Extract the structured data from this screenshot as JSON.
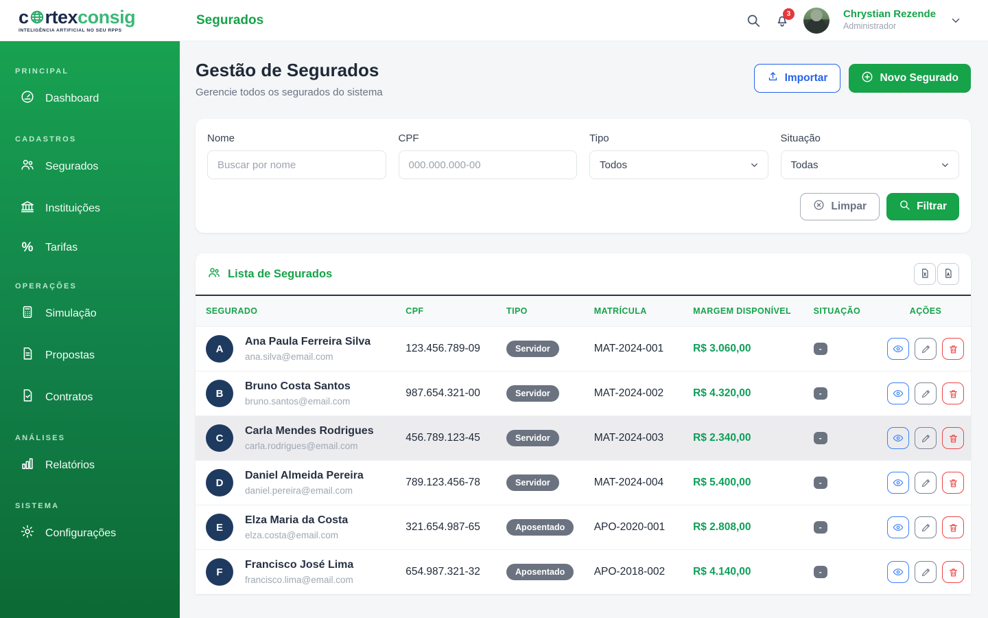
{
  "brand": {
    "part1": "c",
    "part2": "rtex",
    "part3": "consig",
    "tagline": "INTELIGÊNCIA ARTIFICIAL NO SEU RPPS"
  },
  "topbar": {
    "page_label": "Segurados",
    "notification_count": "3",
    "user": {
      "name": "Chrystian Rezende",
      "role": "Administrador"
    }
  },
  "sidebar": {
    "sections": [
      {
        "label": "PRINCIPAL",
        "items": [
          {
            "label": "Dashboard",
            "icon": "gauge-icon"
          }
        ]
      },
      {
        "label": "CADASTROS",
        "items": [
          {
            "label": "Segurados",
            "icon": "people-icon"
          },
          {
            "label": "Instituições",
            "icon": "bank-icon"
          },
          {
            "label": "Tarifas",
            "icon": "percent-icon"
          }
        ]
      },
      {
        "label": "OPERAÇÕES",
        "items": [
          {
            "label": "Simulação",
            "icon": "calculator-icon"
          },
          {
            "label": "Propostas",
            "icon": "document-icon"
          },
          {
            "label": "Contratos",
            "icon": "contract-icon"
          }
        ]
      },
      {
        "label": "ANÁLISES",
        "items": [
          {
            "label": "Relatórios",
            "icon": "bar-chart-icon"
          }
        ]
      },
      {
        "label": "SISTEMA",
        "items": [
          {
            "label": "Configurações",
            "icon": "gear-icon"
          }
        ]
      }
    ]
  },
  "page": {
    "title": "Gestão de Segurados",
    "subtitle": "Gerencie todos os segurados do sistema",
    "import_label": "Importar",
    "new_label": "Novo Segurado"
  },
  "filters": {
    "fields": [
      {
        "label": "Nome",
        "placeholder": "Buscar por nome"
      },
      {
        "label": "CPF",
        "placeholder": "000.000.000-00"
      },
      {
        "label": "Tipo",
        "value": "Todos"
      },
      {
        "label": "Situação",
        "value": "Todas"
      }
    ],
    "clear_label": "Limpar",
    "apply_label": "Filtrar"
  },
  "list": {
    "title": "Lista de Segurados",
    "columns": [
      "SEGURADO",
      "CPF",
      "TIPO",
      "MATRÍCULA",
      "MARGEM DISPONÍVEL",
      "SITUAÇÃO",
      "AÇÕES"
    ],
    "rows": [
      {
        "initial": "A",
        "name": "Ana Paula Ferreira Silva",
        "email": "ana.silva@email.com",
        "cpf": "123.456.789-09",
        "tipo": "Servidor",
        "matricula": "MAT-2024-001",
        "margem": "R$ 3.060,00",
        "situacao": "-"
      },
      {
        "initial": "B",
        "name": "Bruno Costa Santos",
        "email": "bruno.santos@email.com",
        "cpf": "987.654.321-00",
        "tipo": "Servidor",
        "matricula": "MAT-2024-002",
        "margem": "R$ 4.320,00",
        "situacao": "-"
      },
      {
        "initial": "C",
        "name": "Carla Mendes Rodrigues",
        "email": "carla.rodrigues@email.com",
        "cpf": "456.789.123-45",
        "tipo": "Servidor",
        "matricula": "MAT-2024-003",
        "margem": "R$ 2.340,00",
        "situacao": "-"
      },
      {
        "initial": "D",
        "name": "Daniel Almeida Pereira",
        "email": "daniel.pereira@email.com",
        "cpf": "789.123.456-78",
        "tipo": "Servidor",
        "matricula": "MAT-2024-004",
        "margem": "R$ 5.400,00",
        "situacao": "-"
      },
      {
        "initial": "E",
        "name": "Elza Maria da Costa",
        "email": "elza.costa@email.com",
        "cpf": "321.654.987-65",
        "tipo": "Aposentado",
        "matricula": "APO-2020-001",
        "margem": "R$ 2.808,00",
        "situacao": "-"
      },
      {
        "initial": "F",
        "name": "Francisco José Lima",
        "email": "francisco.lima@email.com",
        "cpf": "654.987.321-32",
        "tipo": "Aposentado",
        "matricula": "APO-2018-002",
        "margem": "R$ 4.140,00",
        "situacao": "-"
      }
    ]
  },
  "colors": {
    "accent_green": "#16a34a",
    "sidebar_top": "#18a251",
    "sidebar_bottom": "#0c6a34",
    "blue": "#2563eb",
    "red": "#ef4444",
    "badge_gray": "#6b7280",
    "avatar_navy": "#1e3a5f",
    "margin_green": "#0e9f59"
  }
}
